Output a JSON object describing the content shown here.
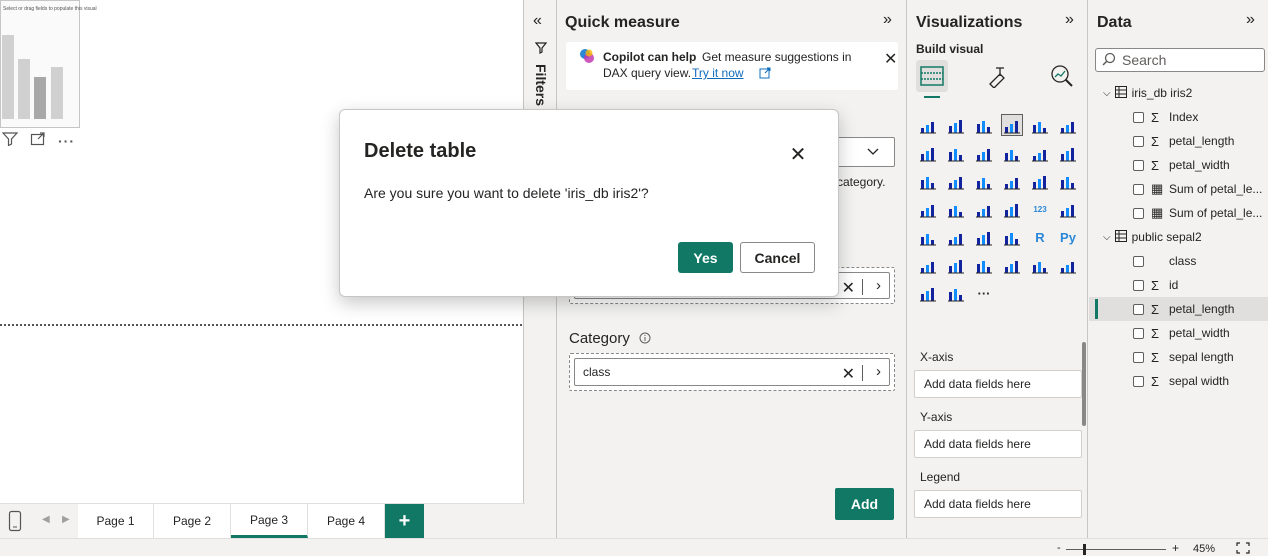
{
  "canvas": {
    "visual_hint": "Select or drag fields to populate this visual"
  },
  "pages": {
    "tabs": [
      {
        "label": "Page 1"
      },
      {
        "label": "Page 2"
      },
      {
        "label": "Page 3",
        "active": true
      },
      {
        "label": "Page 4"
      }
    ],
    "add_label": "+"
  },
  "filters": {
    "label": "Filters"
  },
  "quick_measure": {
    "title": "Quick measure",
    "copilot": {
      "heading": "Copilot can help",
      "text_line1": "Get measure suggestions in",
      "text_line2": "DAX query view.",
      "link": "Try it now"
    },
    "category_hint": "category.",
    "category_label": "Category",
    "category_value": "class",
    "add_button": "Add"
  },
  "visualizations": {
    "title": "Visualizations",
    "build_visual": "Build visual",
    "wells": [
      {
        "label": "X-axis",
        "placeholder": "Add data fields here"
      },
      {
        "label": "Y-axis",
        "placeholder": "Add data fields here"
      },
      {
        "label": "Legend",
        "placeholder": "Add data fields here"
      }
    ]
  },
  "data_pane": {
    "title": "Data",
    "search_placeholder": "Search",
    "tables": [
      {
        "name": "iris_db iris2",
        "fields": [
          {
            "name": "Index",
            "kind": "sigma"
          },
          {
            "name": "petal_length",
            "kind": "sigma"
          },
          {
            "name": "petal_width",
            "kind": "sigma"
          },
          {
            "name": "Sum of petal_le...",
            "kind": "calc"
          },
          {
            "name": "Sum of petal_le...",
            "kind": "calc"
          }
        ]
      },
      {
        "name": "public sepal2",
        "fields": [
          {
            "name": "class",
            "kind": "text"
          },
          {
            "name": "id",
            "kind": "sigma"
          },
          {
            "name": "petal_length",
            "kind": "sigma",
            "selected": true
          },
          {
            "name": "petal_width",
            "kind": "sigma"
          },
          {
            "name": "sepal length",
            "kind": "sigma"
          },
          {
            "name": "sepal width",
            "kind": "sigma"
          }
        ]
      }
    ]
  },
  "dialog": {
    "title": "Delete table",
    "message": "Are you sure you want to delete 'iris_db iris2'?",
    "yes": "Yes",
    "cancel": "Cancel"
  },
  "status": {
    "zoom": "45%"
  },
  "colors": {
    "accent": "#117865"
  }
}
